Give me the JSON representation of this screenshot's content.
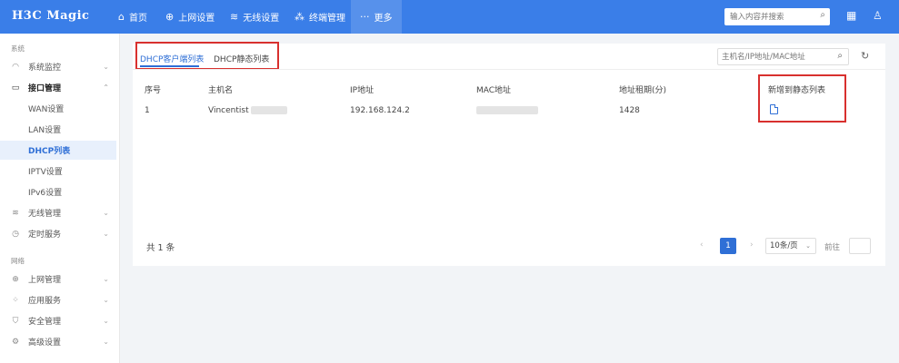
{
  "header": {
    "logo": "H3C Magic",
    "nav": [
      {
        "label": "首页",
        "icon": "home-icon",
        "glyph": "⌂"
      },
      {
        "label": "上网设置",
        "icon": "globe-icon",
        "glyph": "⊕"
      },
      {
        "label": "无线设置",
        "icon": "wifi-icon",
        "glyph": "≋"
      },
      {
        "label": "终端管理",
        "icon": "devices-icon",
        "glyph": "⁂"
      },
      {
        "label": "更多",
        "icon": "more-icon",
        "glyph": "···"
      }
    ],
    "search_placeholder": "输入内容并搜索",
    "accent": "#3a7ee8"
  },
  "sidebar": {
    "group1": "系统",
    "group2": "网络",
    "items": [
      {
        "label": "系统监控",
        "icon": "monitor-icon"
      },
      {
        "label": "接口管理",
        "icon": "interface-icon"
      },
      {
        "label": "WAN设置"
      },
      {
        "label": "LAN设置"
      },
      {
        "label": "DHCP列表"
      },
      {
        "label": "IPTV设置"
      },
      {
        "label": "IPv6设置"
      },
      {
        "label": "无线管理",
        "icon": "wifi-icon"
      },
      {
        "label": "定时服务",
        "icon": "clock-icon"
      },
      {
        "label": "上网管理",
        "icon": "globe-icon"
      },
      {
        "label": "应用服务",
        "icon": "apps-icon"
      },
      {
        "label": "安全管理",
        "icon": "shield-icon"
      },
      {
        "label": "高级设置",
        "icon": "gear-icon"
      }
    ]
  },
  "main": {
    "tabs": [
      "DHCP客户端列表",
      "DHCP静态列表"
    ],
    "table_search_placeholder": "主机名/IP地址/MAC地址",
    "columns": [
      "序号",
      "主机名",
      "IP地址",
      "MAC地址",
      "地址租期(分)",
      "新增到静态列表"
    ],
    "rows": [
      {
        "index": "1",
        "hostname": "Vincentist",
        "ip": "192.168.124.2",
        "mac": "",
        "lease": "1428"
      }
    ],
    "total": "共 1 条",
    "page": "1",
    "page_size": "10条/页",
    "goto": "前往",
    "highlight_color": "#d8302e"
  }
}
